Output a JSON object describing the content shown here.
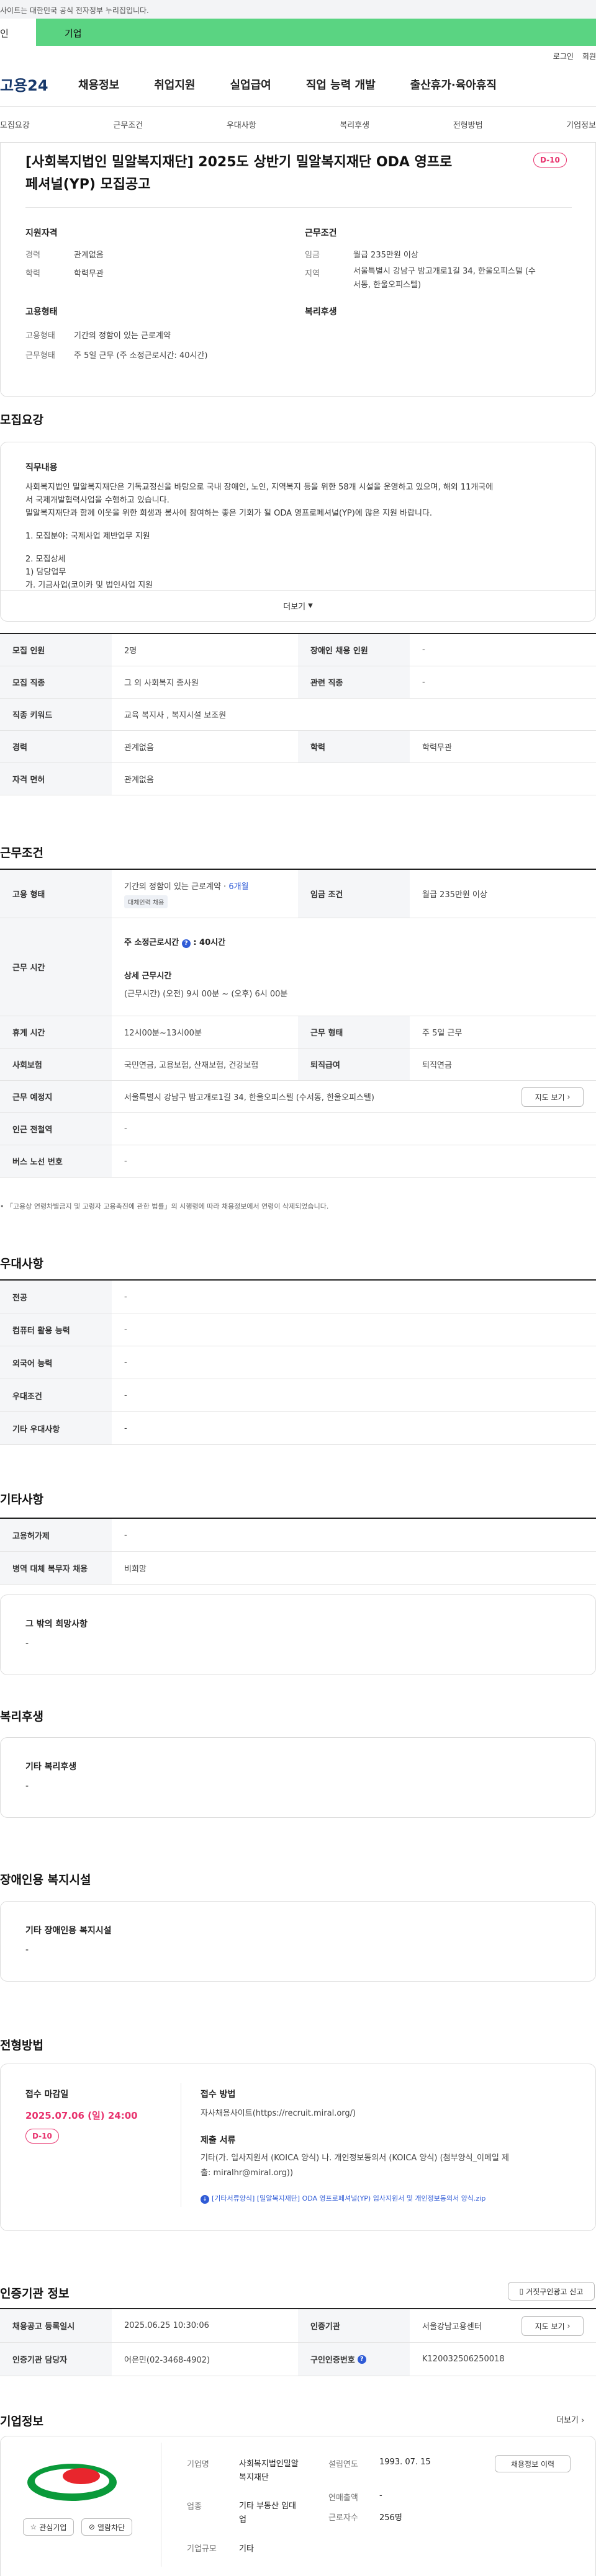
{
  "topbar": {
    "notice": "사이트는 대한민국 공식 전자정부 누리집입니다."
  },
  "user_tabs": {
    "personal": "인",
    "company": "기업"
  },
  "util": {
    "login": "로그인",
    "signup": "회원"
  },
  "gnb": {
    "logo": "고용24",
    "menu": [
      "채용정보",
      "취업지원",
      "실업급여",
      "직업 능력 개발",
      "출산휴가·육아휴직"
    ]
  },
  "subnav": [
    "모집요강",
    "근무조건",
    "우대사항",
    "복리후생",
    "전형방법",
    "기업정보"
  ],
  "header": {
    "title_line1": "[사회복지법인 밀알복지재단] 2025도 상반기 밀알복지재단 ODA 영프로",
    "title_line2": "페셔널(YP) 모집공고",
    "dday": "D-10",
    "qual_title": "지원자격",
    "career_k": "경력",
    "career_v": "관계없음",
    "edu_k": "학력",
    "edu_v": "학력무관",
    "cond_title": "근무조건",
    "wage_k": "임금",
    "wage_v": "월급 235만원 이상",
    "loc_k": "지역",
    "loc_v1": "서울특별시 강남구 밤고개로1길 34, 한울오피스텔 (수",
    "loc_v2": "서동, 한울오피스텔)",
    "emp_title": "고용형태",
    "emptype_k": "고용형태",
    "emptype_v": "기간의 정함이 있는 근로계약",
    "worktime_k": "근무형태",
    "worktime_v": "주 5일 근무 (주 소정근로시간: 40시간)",
    "welfare_title": "복리후생"
  },
  "recruit": {
    "section": "모집요강",
    "box_title": "직무내용",
    "p1": "사회복지법인 밀알복지재단은 기독교정신을 바탕으로 국내 장애인, 노인, 지역복지 등을 위한 58개 시설을 운영하고 있으며, 해외 11개국에",
    "p2": "서 국제개발협력사업을 수행하고 있습니다.",
    "p3": "밀알복지재단과 함께 이웃을 위한 희생과 봉사에 참여하는 좋은 기회가 될 ODA 영프로페셔널(YP)에 많은 지원 바랍니다.",
    "l1": "1. 모집분야: 국제사업 제반업무 지원",
    "l2": "2. 모집상세",
    "l3": "1) 담당업무",
    "l4": "가. 기금사업(코이카 및 법인사업 지원",
    "more": "더보기",
    "rows": [
      [
        "모집 인원",
        "2명",
        "장애인 채용 인원",
        "-"
      ],
      [
        "모집 직종",
        "그 외 사회복지 종사원",
        "관련 직종",
        "-"
      ],
      [
        "직종 키워드",
        "교육 복지사 , 복지시설 보조원",
        "",
        ""
      ],
      [
        "경력",
        "관계없음",
        "학력",
        "학력무관"
      ],
      [
        "자격 면허",
        "관계없음",
        "",
        ""
      ]
    ]
  },
  "work": {
    "section": "근무조건",
    "emp_k": "고용 형태",
    "emp_v": "기간의 정함이 있는 근로계약 ·",
    "emp_months": "6개월",
    "emp_tag": "대체인력 채용",
    "wage_k": "임금 조건",
    "wage_v": "월급 235만원 이상",
    "hours_k": "근무 시간",
    "hours_h1": "주 소정근로시간",
    "hours_h1v": ": 40시간",
    "hours_h2": "상세 근무시간",
    "hours_v": "(근무시간) (오전) 9시 00분 ~ (오후) 6시 00분",
    "break_k": "휴게 시간",
    "break_v": "12시00분~13시00분",
    "type_k": "근무 형태",
    "type_v": "주 5일 근무",
    "ins_k": "사회보험",
    "ins_v": "국민연금, 고용보험, 산재보험, 건강보험",
    "ret_k": "퇴직급여",
    "ret_v": "퇴직연금",
    "place_k": "근무 예정지",
    "place_v": "서울특별시 강남구 밤고개로1길 34, 한울오피스텔 (수서동, 한울오피스텔)",
    "map_btn": "지도 보기",
    "sub_k": "인근 전철역",
    "sub_v": "-",
    "bus_k": "버스 노선 번호",
    "bus_v": "-",
    "footnote": "「고용상 연령차별금지 및 고령자 고용촉진에 관한 법률」의 시행령에 따라 채용정보에서 연령이 삭제되었습니다."
  },
  "pref": {
    "section": "우대사항",
    "rows": [
      [
        "전공",
        "-"
      ],
      [
        "컴퓨터 활용 능력",
        "-"
      ],
      [
        "외국어 능력",
        "-"
      ],
      [
        "우대조건",
        "-"
      ],
      [
        "기타 우대사항",
        "-"
      ]
    ]
  },
  "etc": {
    "section": "기타사항",
    "rows": [
      [
        "고용허가제",
        "-"
      ],
      [
        "병역 대체 복무자 채용",
        "비희망"
      ]
    ],
    "box_title": "그 밖의 희망사항",
    "box_val": "-"
  },
  "welfare": {
    "section": "복리후생",
    "box_title": "기타 복리후생",
    "box_val": "-"
  },
  "disabled": {
    "section": "장애인용 복지시설",
    "box_title": "기타 장애인용 복지시설",
    "box_val": "-"
  },
  "process": {
    "section": "전형방법",
    "deadline_k": "접수 마감일",
    "deadline_v": "2025.07.06 (일) 24:00",
    "dday": "D-10",
    "method_k": "접수 방법",
    "method_v": "자사채용사이트(https://recruit.miral.org/)",
    "docs_k": "제출 서류",
    "docs_v1": "기타(가. 입사지원서 (KOICA 양식) 나. 개인정보동의서 (KOICA 양식) (첨부양식_이메일 제",
    "docs_v2": "출: miralhr@miral.org))",
    "file": "[기타서류양식] [밀알복지재단] ODA 영프로페셔널(YP) 입사지원서 및 개인정보동의서 양식.zip"
  },
  "cert": {
    "section": "인증기관 정보",
    "report_btn": "거짓구인광고 신고",
    "reg_k": "채용공고 등록일시",
    "reg_v": "2025.06.25 10:30:06",
    "org_k": "인증기관",
    "org_v": "서울강남고용센터",
    "map_btn": "지도 보기",
    "mgr_k": "인증기관 담당자",
    "mgr_v": "어은민(02-3468-4902)",
    "id_k": "구인인증번호",
    "id_v": "K120032506250018"
  },
  "company": {
    "section": "기업정보",
    "more": "더보기",
    "fav_btn": "관심기업",
    "block_btn": "열람차단",
    "name_k": "기업명",
    "name_v1": "사회복지법인밀알",
    "name_v2": "복지재단",
    "est_k": "설립연도",
    "est_v": "1993. 07. 15",
    "jobs_btn": "채용정보 이력",
    "ind_k": "업종",
    "ind_v1": "기타 부동산 임대",
    "ind_v2": "업",
    "sales_k": "연매출액",
    "sales_v": "-",
    "emp_k": "근로자수",
    "emp_v": "256명",
    "size_k": "기업규모",
    "size_v": "기타"
  },
  "colors": {
    "green": "#5ad482",
    "red": "#e8336e",
    "blue": "#2f5bd6",
    "navy": "#17386b"
  }
}
